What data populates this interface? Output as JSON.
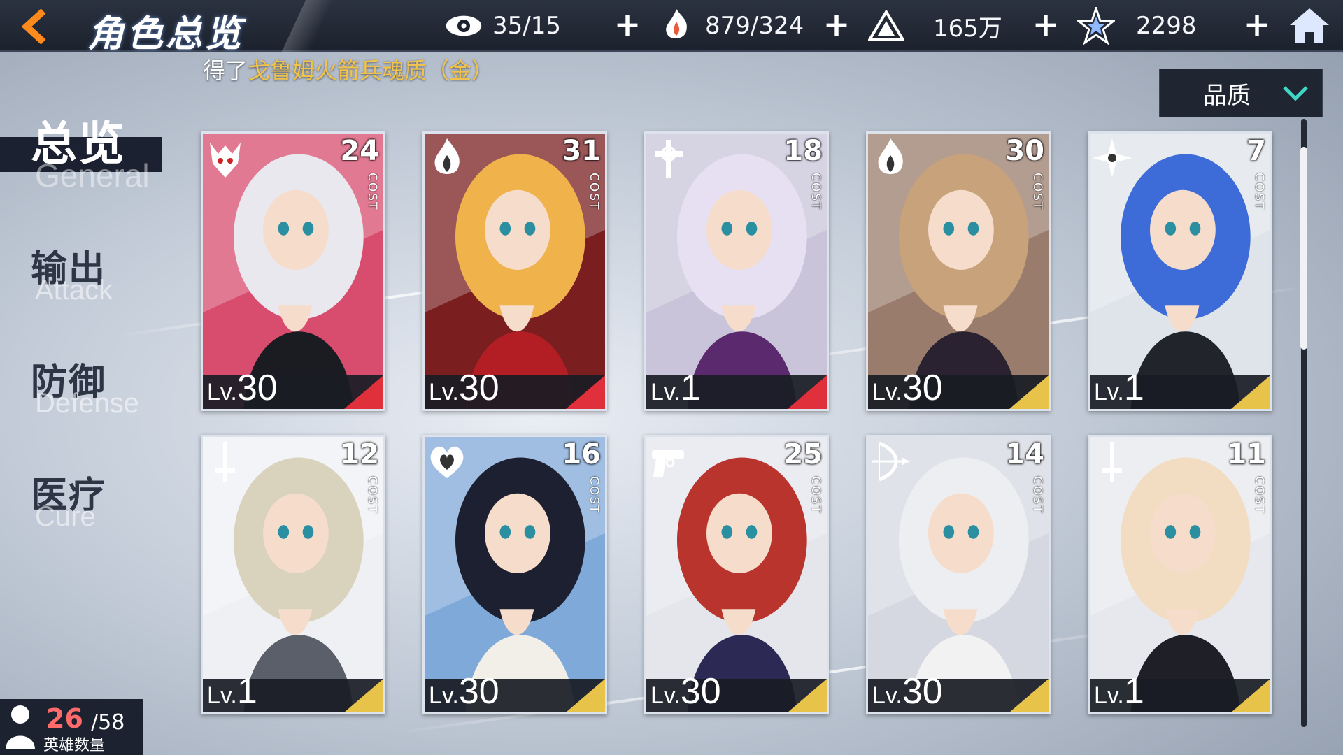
{
  "header": {
    "title": "角色总览",
    "back_icon": "back-arrow-icon",
    "resources": [
      {
        "name": "stamina",
        "icon": "eye-icon",
        "value": "35/15"
      },
      {
        "name": "soul",
        "icon": "flame-hand-icon",
        "value": "879/324"
      },
      {
        "name": "gold",
        "icon": "pyramid-icon",
        "value": "165万"
      },
      {
        "name": "crystal",
        "icon": "star-crystal-icon",
        "value": "2298"
      }
    ],
    "home_icon": "home-icon"
  },
  "notice": {
    "prefix": "得了",
    "highlight": "戈鲁姆火箭兵魂质（金）"
  },
  "sort": {
    "label": "品质"
  },
  "nav": [
    {
      "cn": "总览",
      "en": "General",
      "active": true
    },
    {
      "cn": "输出",
      "en": "Attack",
      "active": false
    },
    {
      "cn": "防御",
      "en": "Defense",
      "active": false
    },
    {
      "cn": "医疗",
      "en": "Cure",
      "active": false
    }
  ],
  "cost_label": "COST",
  "lv_prefix": "Lv.",
  "cards": [
    {
      "cost": "24",
      "level": "30",
      "role": "demon-icon",
      "rarity": "red",
      "hair": "#e8e8ee",
      "outfit": "#1b1b22",
      "bg": "#d84d6e"
    },
    {
      "cost": "31",
      "level": "30",
      "role": "flame-icon",
      "rarity": "red",
      "hair": "#f0b24a",
      "outfit": "#b21e24",
      "bg": "#7a1e20"
    },
    {
      "cost": "18",
      "level": "1",
      "role": "cross-icon",
      "rarity": "red",
      "hair": "#e6e0f2",
      "outfit": "#5b2a6e",
      "bg": "#c9c4da"
    },
    {
      "cost": "30",
      "level": "30",
      "role": "flame-icon",
      "rarity": "gold",
      "hair": "#c7a27a",
      "outfit": "#2a2230",
      "bg": "#9a7c6c"
    },
    {
      "cost": "7",
      "level": "1",
      "role": "shuriken-icon",
      "rarity": "gold",
      "hair": "#3d6bd8",
      "outfit": "#22242c",
      "bg": "#dfe3ea"
    },
    {
      "cost": "12",
      "level": "1",
      "role": "sword-icon",
      "rarity": "gold",
      "hair": "#d9d2bc",
      "outfit": "#5b5f6a",
      "bg": "#eef0f4"
    },
    {
      "cost": "16",
      "level": "30",
      "role": "heart-icon",
      "rarity": "gold",
      "hair": "#1d2030",
      "outfit": "#f2efe8",
      "bg": "#7fa9d8"
    },
    {
      "cost": "25",
      "level": "30",
      "role": "pistol-icon",
      "rarity": "gold",
      "hair": "#b8342c",
      "outfit": "#2c2a55",
      "bg": "#e4e6ec"
    },
    {
      "cost": "14",
      "level": "30",
      "role": "bow-icon",
      "rarity": "gold",
      "hair": "#eceef2",
      "outfit": "#f2f2f2",
      "bg": "#d5d8e0"
    },
    {
      "cost": "11",
      "level": "1",
      "role": "sword-icon",
      "rarity": "gold",
      "hair": "#f2dcc2",
      "outfit": "#1f1f28",
      "bg": "#e6e8ee"
    }
  ],
  "hero_count": {
    "current": "26",
    "max": "/58",
    "label": "英雄数量"
  }
}
